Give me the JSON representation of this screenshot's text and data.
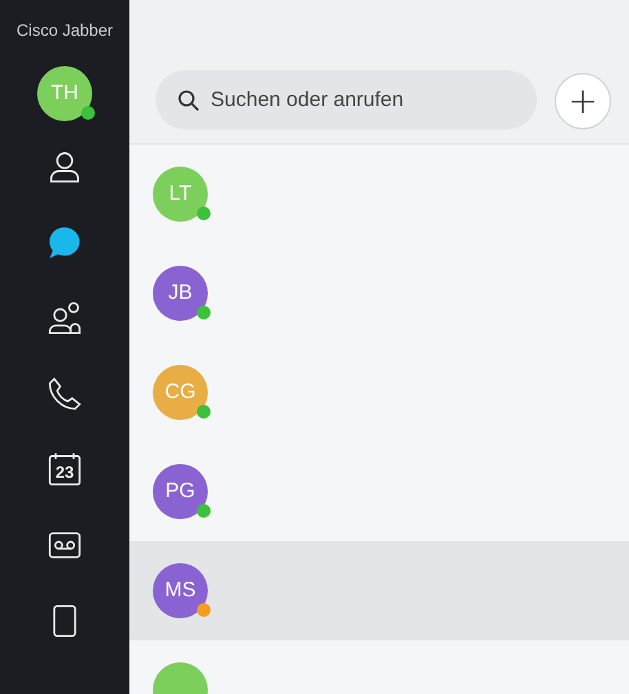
{
  "app_title": "Cisco Jabber",
  "user_avatar": {
    "initials": "TH",
    "color": "#7dcf5c",
    "away": false
  },
  "nav_items": [
    {
      "kind": "contacts",
      "selected": false
    },
    {
      "kind": "chats",
      "selected": true
    },
    {
      "kind": "meetings",
      "selected": false
    },
    {
      "kind": "calls",
      "selected": false
    },
    {
      "kind": "calendar",
      "label": "23",
      "selected": false
    },
    {
      "kind": "voicemail",
      "selected": false
    },
    {
      "kind": "more",
      "selected": false
    }
  ],
  "search": {
    "placeholder": "Suchen oder anrufen"
  },
  "add_button": {
    "label": "+"
  },
  "conversations": [
    {
      "initials": "LT",
      "color": "#7dcf5c",
      "away": false,
      "selected": false
    },
    {
      "initials": "JB",
      "color": "#8a63d2",
      "away": false,
      "selected": false
    },
    {
      "initials": "CG",
      "color": "#e8ad45",
      "away": false,
      "selected": false
    },
    {
      "initials": "PG",
      "color": "#8a63d2",
      "away": false,
      "selected": false
    },
    {
      "initials": "MS",
      "color": "#8a63d2",
      "away": true,
      "selected": true
    },
    {
      "color": "#7dcf5c",
      "selected": false
    }
  ]
}
